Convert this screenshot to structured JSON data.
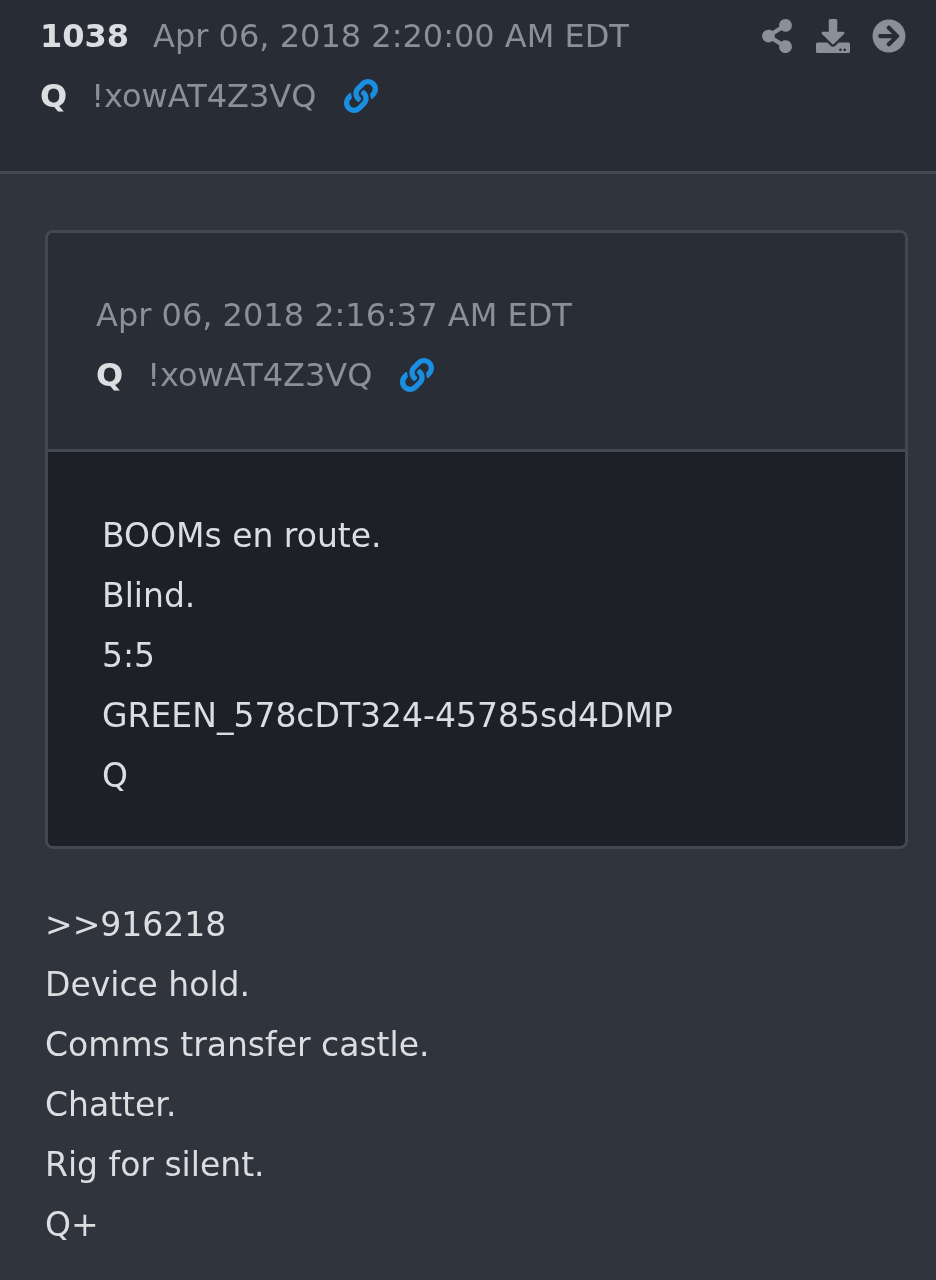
{
  "post": {
    "number": "1038",
    "date": "Apr 06, 2018 2:20:00 AM EDT",
    "author": "Q",
    "tripcode": "!xowAT4Z3VQ"
  },
  "quote": {
    "date": "Apr 06, 2018 2:16:37 AM EDT",
    "author": "Q",
    "tripcode": "!xowAT4Z3VQ",
    "lines": [
      "BOOMs en route.",
      "Blind.",
      "5:5",
      "GREEN_578cDT324-45785sd4DMP",
      "Q"
    ]
  },
  "lines": [
    ">>916218",
    "Device hold.",
    "Comms transfer castle.",
    "Chatter.",
    "Rig for silent.",
    "Q+"
  ]
}
